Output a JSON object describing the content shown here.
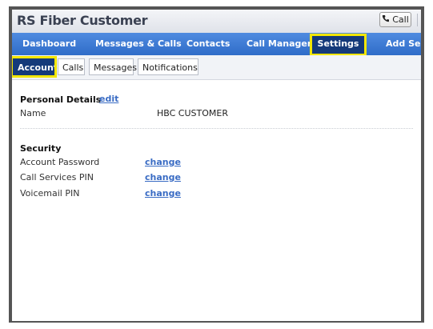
{
  "app": {
    "title": "RS Fiber Customer",
    "call_button_label": "Call"
  },
  "nav": {
    "items": [
      {
        "label": "Dashboard"
      },
      {
        "label": "Messages & Calls"
      },
      {
        "label": "Contacts"
      },
      {
        "label": "Call Manager"
      },
      {
        "label": "Settings",
        "active": true
      },
      {
        "label": "Add Ser"
      }
    ]
  },
  "subtabs": {
    "items": [
      {
        "label": "Account",
        "active": true
      },
      {
        "label": "Calls"
      },
      {
        "label": "Messages"
      },
      {
        "label": "Notifications"
      }
    ]
  },
  "personal": {
    "title": "Personal Details",
    "edit_label": "edit",
    "name_label": "Name",
    "name_value": "HBC CUSTOMER"
  },
  "security": {
    "title": "Security",
    "rows": [
      {
        "label": "Account Password",
        "action": "change"
      },
      {
        "label": "Call Services PIN",
        "action": "change"
      },
      {
        "label": "Voicemail PIN",
        "action": "change"
      }
    ]
  },
  "colors": {
    "nav_blue": "#3a78d6",
    "active_dark": "#153a7a",
    "highlight_yellow": "#f2e600",
    "link_blue": "#3a6cc4"
  }
}
